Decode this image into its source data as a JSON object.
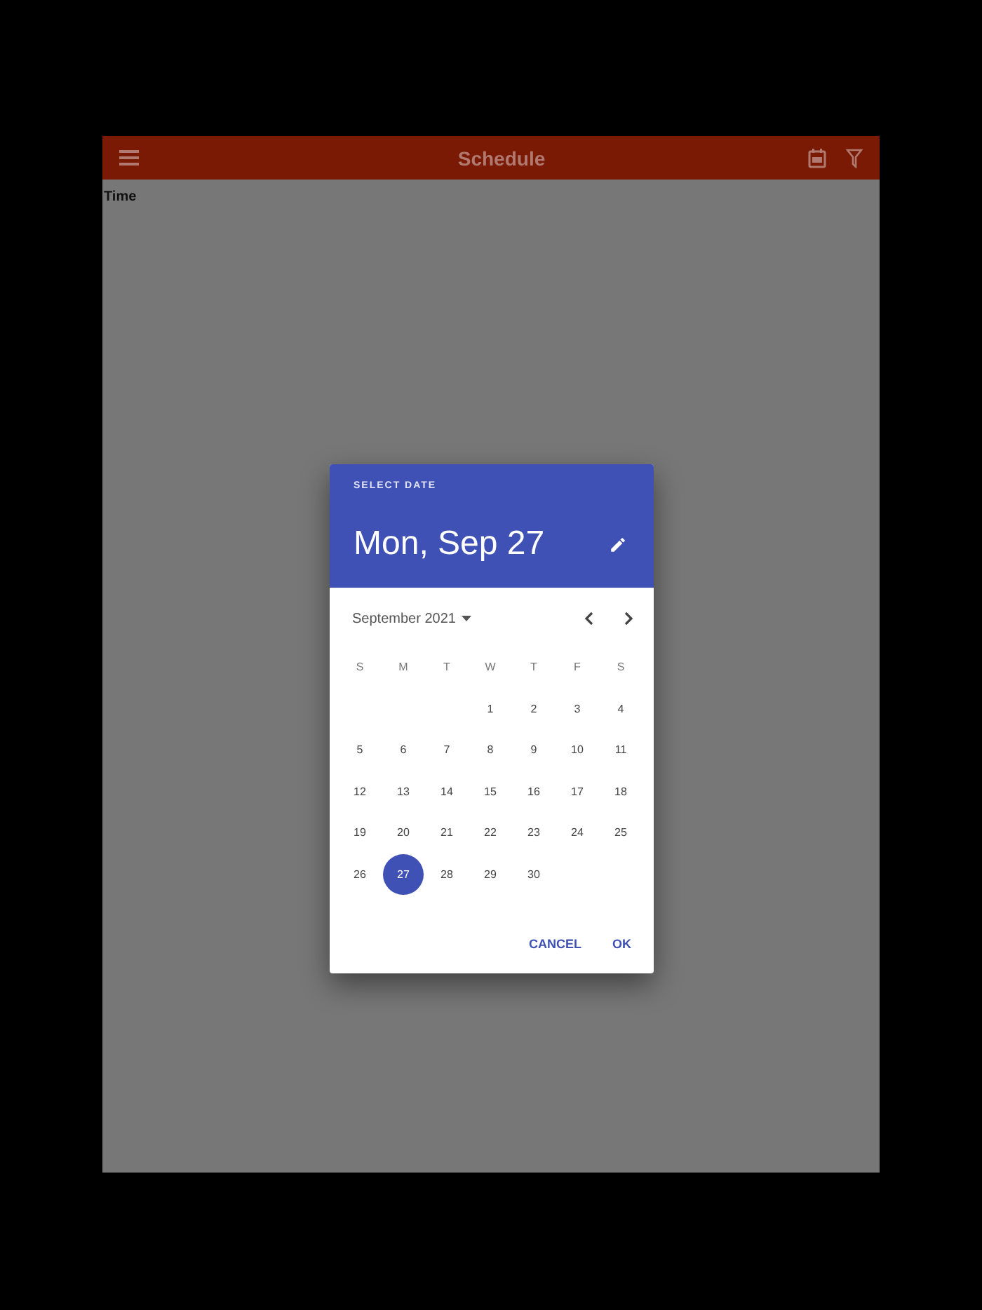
{
  "app_bar": {
    "title": "Schedule"
  },
  "content": {
    "header": "Time"
  },
  "dialog": {
    "caption": "SELECT DATE",
    "date": "Mon, Sep 27",
    "month": "September 2021",
    "weekdays": [
      "S",
      "M",
      "T",
      "W",
      "T",
      "F",
      "S"
    ],
    "weeks": [
      [
        {
          "day": "1",
          "selected": false
        },
        {
          "day": "2",
          "selected": false
        },
        {
          "day": "3",
          "selected": false
        },
        {
          "day": "4",
          "selected": false
        }
      ],
      [
        {
          "day": "5",
          "selected": false
        },
        {
          "day": "6",
          "selected": false
        },
        {
          "day": "7",
          "selected": false
        },
        {
          "day": "8",
          "selected": false
        },
        {
          "day": "9",
          "selected": false
        },
        {
          "day": "10",
          "selected": false
        },
        {
          "day": "11",
          "selected": false
        }
      ],
      [
        {
          "day": "12",
          "selected": false
        },
        {
          "day": "13",
          "selected": false
        },
        {
          "day": "14",
          "selected": false
        },
        {
          "day": "15",
          "selected": false
        },
        {
          "day": "16",
          "selected": false
        },
        {
          "day": "17",
          "selected": false
        },
        {
          "day": "18",
          "selected": false
        }
      ],
      [
        {
          "day": "19",
          "selected": false
        },
        {
          "day": "20",
          "selected": false
        },
        {
          "day": "21",
          "selected": false
        },
        {
          "day": "22",
          "selected": false
        },
        {
          "day": "23",
          "selected": false
        },
        {
          "day": "24",
          "selected": false
        },
        {
          "day": "25",
          "selected": false
        }
      ],
      [
        {
          "day": "26",
          "selected": false
        },
        {
          "day": "27",
          "selected": true
        },
        {
          "day": "28",
          "selected": false
        },
        {
          "day": "29",
          "selected": false
        },
        {
          "day": "30",
          "selected": false
        }
      ]
    ],
    "buttons": [
      "CANCEL",
      "OK"
    ]
  }
}
